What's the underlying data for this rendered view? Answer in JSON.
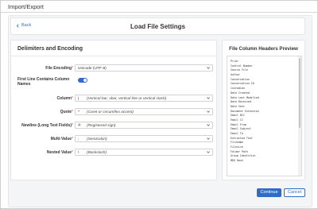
{
  "window": {
    "title": "Import/Export"
  },
  "header": {
    "back_label": "Back",
    "title": "Load File Settings"
  },
  "delimiters": {
    "section_title": "Delimiters and Encoding",
    "file_encoding": {
      "label": "File Encoding",
      "value": "Unicode (UTF-8)"
    },
    "first_line": {
      "label_line1": "First Line Contains Column",
      "label_line2": "Names",
      "enabled": true
    },
    "column": {
      "label": "Column",
      "symbol": "|",
      "description": "(Vertical-bar, vbar, vertical line or vertical slash)"
    },
    "quote": {
      "label": "Quote",
      "symbol": "^",
      "description": "(Caret or circumflex accent)"
    },
    "newline": {
      "label": "Newline (Long Text Fields)",
      "symbol": "®",
      "description": "(Registered sign)"
    },
    "multi_value": {
      "label": "Multi-Value",
      "symbol": ";",
      "description": "(Semicolon)"
    },
    "nested_value": {
      "label": "Nested Value",
      "symbol": "\\",
      "description": "(Backslash)"
    },
    "required_marker": "*"
  },
  "preview": {
    "title": "File Column Headers Preview",
    "lines": [
      "Prior",
      "Control Number",
      "Source File",
      "Author",
      "Conversation",
      "Conversation ID",
      "Custodian",
      "Date Created",
      "Date Last Modified",
      "Date Received",
      "Date Sent",
      "Document Extension",
      "Email BCC",
      "Email CC",
      "Email From",
      "Email Subject",
      "Email To",
      "Extracted Text",
      "Filename",
      "Filesize",
      "Folder Path",
      "Group Identifier",
      "MD5 Hash"
    ]
  },
  "footer": {
    "continue_label": "Continue",
    "cancel_label": "Cancel"
  },
  "colors": {
    "accent": "#2f6dc4",
    "required": "#d9363e"
  },
  "icons": {
    "back": "chevron-left-icon",
    "dropdown": "chevron-down-icon"
  }
}
